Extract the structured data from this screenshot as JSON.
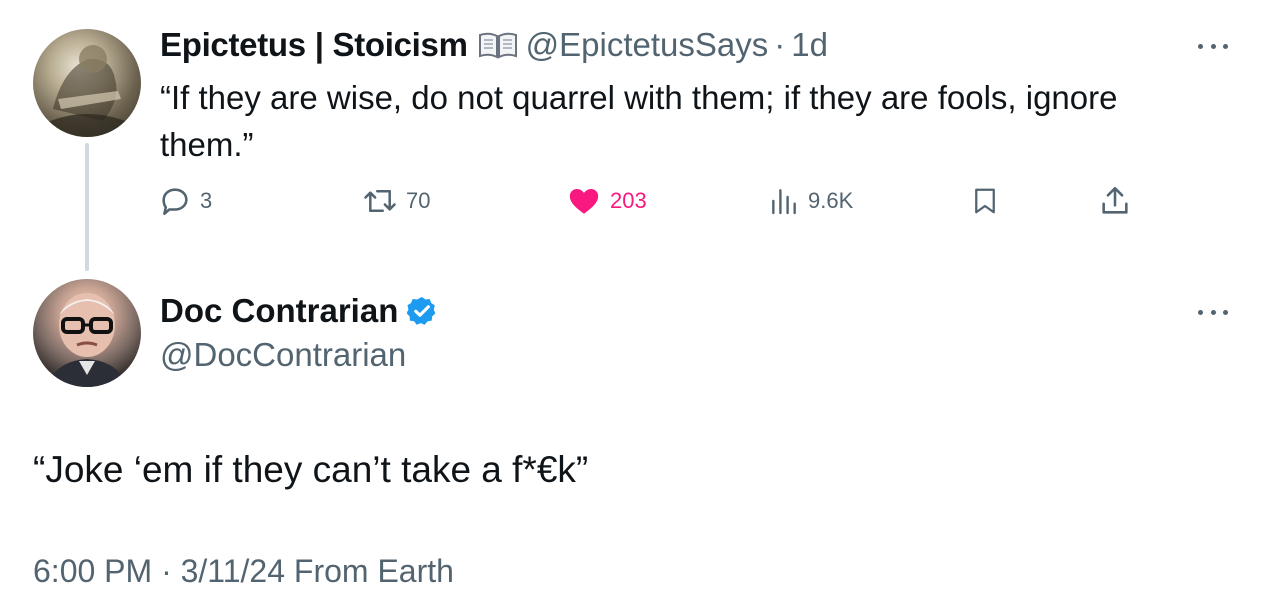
{
  "parent_tweet": {
    "author_name": "Epictetus | Stoicism",
    "name_emoji": "open-book-icon",
    "handle": "@EpictetusSays",
    "separator": "·",
    "time_ago": "1d",
    "text": "“If they are wise, do not quarrel with them; if they are fools, ignore them.”",
    "actions": {
      "replies": "3",
      "retweets": "70",
      "likes": "203",
      "views": "9.6K"
    },
    "liked": true,
    "like_color": "#f91880"
  },
  "main_tweet": {
    "author_name": "Doc Contrarian",
    "verified": true,
    "verified_color": "#1d9bf0",
    "handle": "@DocContrarian",
    "text": "“Joke ‘em if they can’t take a f*€k”",
    "meta": "6:00 PM · 3/11/24 From Earth"
  },
  "icons": [
    "reply-icon",
    "retweet-icon",
    "heart-icon",
    "views-icon",
    "bookmark-icon",
    "share-icon",
    "more-icon",
    "verified-badge-icon"
  ]
}
